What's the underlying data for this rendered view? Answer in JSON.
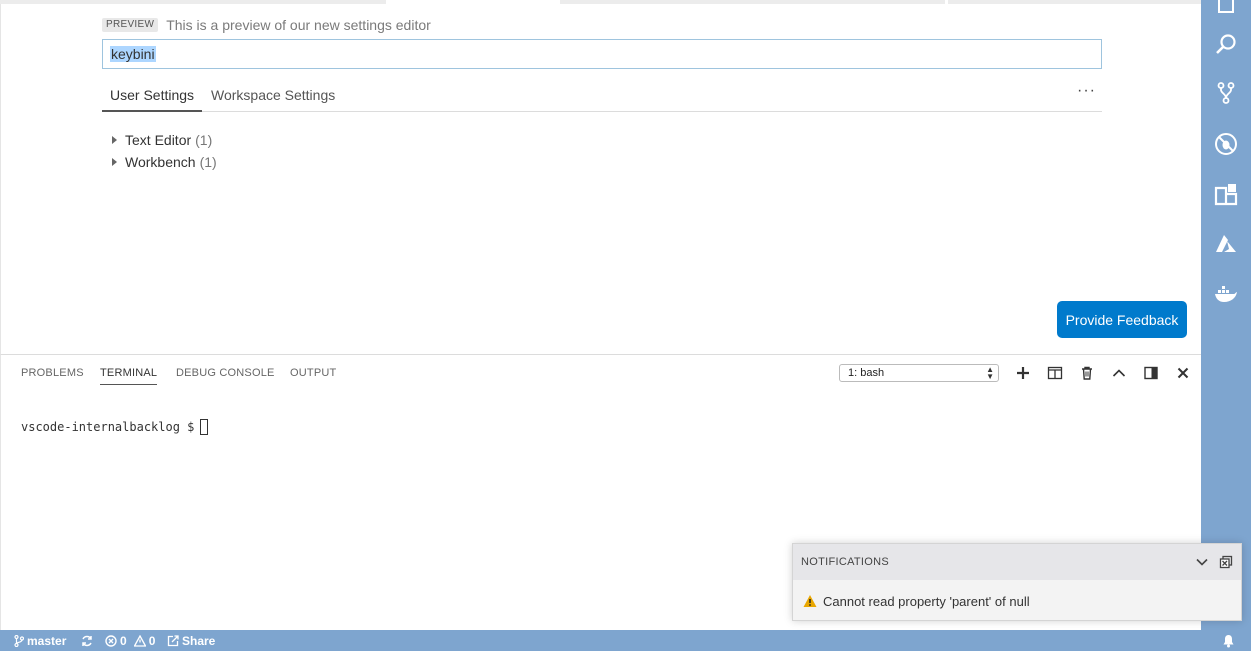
{
  "settings": {
    "preview_badge": "PREVIEW",
    "preview_text": "This is a preview of our new settings editor",
    "search_value": "keybini",
    "tabs": [
      {
        "label": "User Settings",
        "active": true
      },
      {
        "label": "Workspace Settings",
        "active": false
      }
    ],
    "more_label": "···",
    "tree": [
      {
        "label": "Text Editor",
        "count": "(1)"
      },
      {
        "label": "Workbench",
        "count": "(1)"
      }
    ],
    "feedback_button": "Provide Feedback"
  },
  "panel": {
    "tabs": [
      "PROBLEMS",
      "TERMINAL",
      "DEBUG CONSOLE",
      "OUTPUT"
    ],
    "active_tab": "TERMINAL",
    "terminal_select": "1: bash",
    "terminal_prompt": "vscode-internalbacklog $"
  },
  "notifications": {
    "header": "NOTIFICATIONS",
    "message": "Cannot read property 'parent' of null"
  },
  "statusbar": {
    "branch": "master",
    "errors": "0",
    "warnings": "0",
    "share": "Share"
  },
  "colors": {
    "accent": "#007acc",
    "activity_bar": "#7ea5cf",
    "status_bar": "#7ea5cf"
  },
  "icons": {
    "activity": [
      "explorer-icon",
      "search-icon",
      "source-control-icon",
      "debug-icon",
      "extensions-icon",
      "azure-icon",
      "docker-icon"
    ],
    "panel_actions": [
      "plus-icon",
      "split-terminal-icon",
      "trash-icon",
      "chevron-up-icon",
      "panel-layout-icon",
      "close-icon"
    ]
  }
}
